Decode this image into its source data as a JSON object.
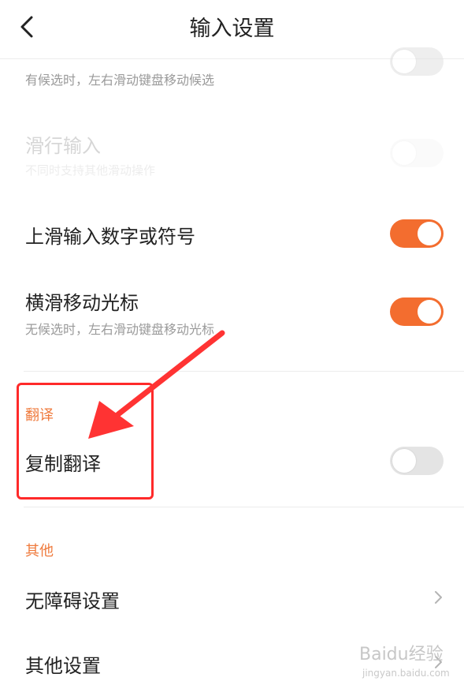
{
  "header": {
    "title": "输入设置"
  },
  "rows": {
    "move_candidate_sub": "有候选时，左右滑动键盘移动候选",
    "glide_input": {
      "label": "滑行输入",
      "sub": "不同时支持其他滑动操作"
    },
    "swipe_up_symbols": {
      "label": "上滑输入数字或符号",
      "state": "on"
    },
    "swipe_cursor": {
      "label": "横滑移动光标",
      "sub": "无候选时，左右滑动键盘移动光标",
      "state": "on"
    }
  },
  "sections": {
    "translate": {
      "title": "翻译",
      "copy_translate": {
        "label": "复制翻译",
        "state": "off"
      }
    },
    "other": {
      "title": "其他",
      "accessibility": "无障碍设置",
      "other_settings": "其他设置"
    }
  },
  "watermark": {
    "brand": "Baidu经验",
    "url": "jingyan.baidu.com"
  },
  "colors": {
    "accent": "#f36d2f",
    "section_title": "#ef7a3c",
    "annotation": "#ff2a2a"
  },
  "icons": {
    "back": "chevron-left-icon",
    "row_arrow": "chevron-right-icon"
  }
}
